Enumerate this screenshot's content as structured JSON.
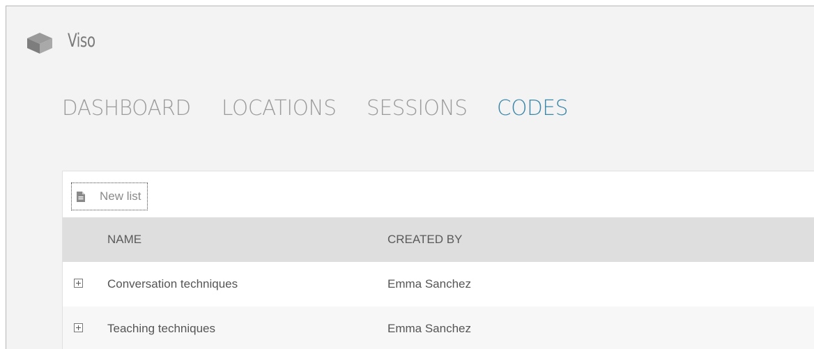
{
  "app": {
    "title": "Viso",
    "logo_icon": "cube-icon"
  },
  "nav": {
    "items": [
      {
        "label": "DASHBOARD",
        "active": false
      },
      {
        "label": "LOCATIONS",
        "active": false
      },
      {
        "label": "SESSIONS",
        "active": false
      },
      {
        "label": "CODES",
        "active": true
      }
    ],
    "active_color": "#3b87a8",
    "inactive_color": "#9b9b9b"
  },
  "toolbar": {
    "new_list_label": "New list",
    "new_list_icon": "document-icon"
  },
  "table": {
    "columns": [
      "NAME",
      "CREATED BY"
    ],
    "rows": [
      {
        "name": "Conversation techniques",
        "created_by": "Emma Sanchez",
        "expander_icon": "expand-plus-icon"
      },
      {
        "name": "Teaching techniques",
        "created_by": "Emma Sanchez",
        "expander_icon": "expand-plus-icon"
      }
    ]
  }
}
